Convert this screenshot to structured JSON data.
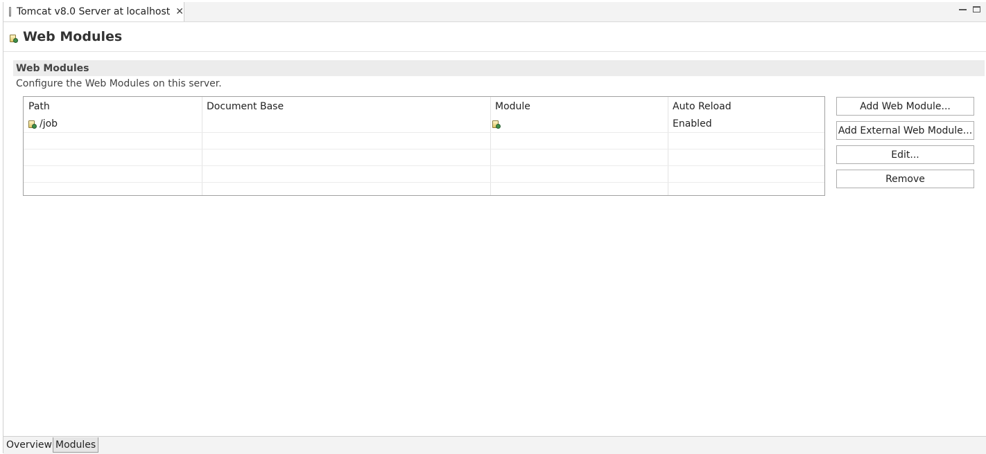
{
  "editor_tab": {
    "title": "Tomcat v8.0 Server at localhost",
    "close_glyph": "✕"
  },
  "header": {
    "title": "Web Modules"
  },
  "section": {
    "title": "Web Modules",
    "description": "Configure the Web Modules on this server."
  },
  "table": {
    "columns": [
      "Path",
      "Document Base",
      "Module",
      "Auto Reload"
    ],
    "rows": [
      {
        "path": "/job",
        "document_base": "",
        "module": "",
        "auto_reload": "Enabled"
      }
    ]
  },
  "buttons": {
    "add_web_module": "Add Web Module...",
    "add_external_web_module": "Add External Web Module...",
    "edit": "Edit...",
    "remove": "Remove"
  },
  "bottom_tabs": [
    "Overview",
    "Modules"
  ],
  "active_bottom_tab": "Modules"
}
